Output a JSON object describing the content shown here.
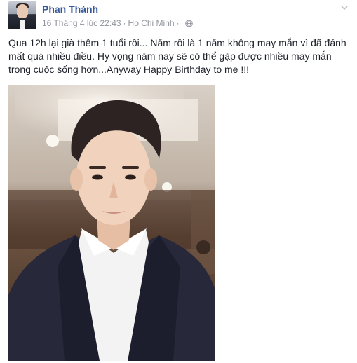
{
  "post": {
    "author": "Phan Thành",
    "timestamp": "16 Tháng 4 lúc 22:43",
    "separator": "·",
    "location": "Ho Chi Minh",
    "message": "Qua 12h lại già thêm 1 tuổi rồi... Năm rồi là 1 năm không may mắn vì đã đánh mất quá nhiều điều. Hy vọng năm nay sẽ có thể gặp được nhiều may mắn trong cuộc sống hơn...Anyway Happy Birthday to me !!!",
    "privacy_icon": "globe-icon",
    "options_icon": "chevron-down-icon"
  },
  "colors": {
    "author_link": "#365899",
    "meta_text": "#90949c",
    "body_text": "#1d2129"
  }
}
